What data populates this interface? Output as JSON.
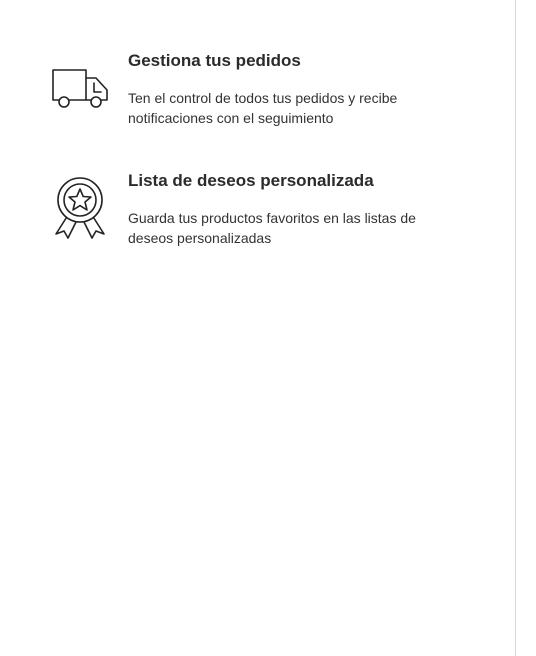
{
  "features": [
    {
      "icon": "delivery-truck-icon",
      "title": "Gestiona tus pedidos",
      "description": "Ten el control de todos tus pedidos y recibe notificaciones con el seguimiento"
    },
    {
      "icon": "award-ribbon-star-icon",
      "title": "Lista de deseos personalizada",
      "description": "Guarda tus productos favoritos en las listas de deseos personalizadas"
    }
  ]
}
